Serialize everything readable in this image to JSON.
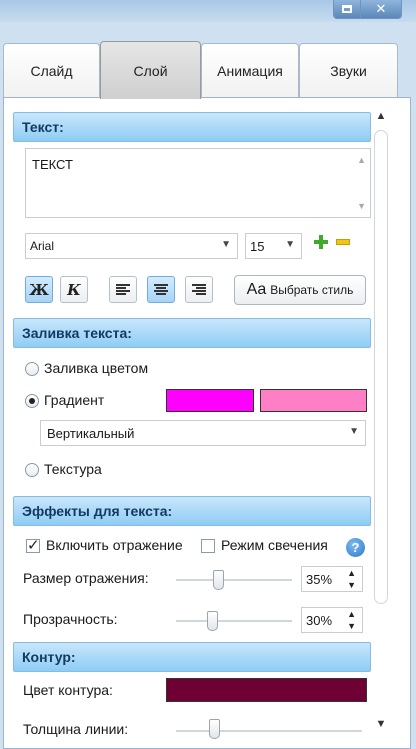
{
  "tabs": [
    {
      "label": "Слайд"
    },
    {
      "label": "Слой"
    },
    {
      "label": "Анимация"
    },
    {
      "label": "Звуки"
    }
  ],
  "sections": {
    "text": "Текст:",
    "fill": "Заливка текста:",
    "effects": "Эффекты для текста:",
    "contour": "Контур:"
  },
  "text_value": "ТЕКСТ",
  "font": {
    "family": "Arial",
    "size": "15"
  },
  "format": {
    "bold_label": "Ж",
    "italic_label": "К",
    "style_button_prefix": "Aa",
    "style_button_label": "Выбрать стиль"
  },
  "fill": {
    "color_fill_label": "Заливка цветом",
    "gradient_label": "Градиент",
    "gradient_color_1": "#ff00ff",
    "gradient_color_2": "#ff7fc6",
    "gradient_direction": "Вертикальный",
    "texture_label": "Текстура",
    "selected": "gradient"
  },
  "effects": {
    "reflection_label": "Включить отражение",
    "reflection_checked": true,
    "glow_label": "Режим свечения",
    "glow_checked": false,
    "reflection_size_label": "Размер отражения:",
    "reflection_size_value": "35%",
    "transparency_label": "Прозрачность:",
    "transparency_value": "30%"
  },
  "contour": {
    "color_label": "Цвет контура:",
    "color": "#6e0033",
    "width_label": "Толщина линии:"
  }
}
